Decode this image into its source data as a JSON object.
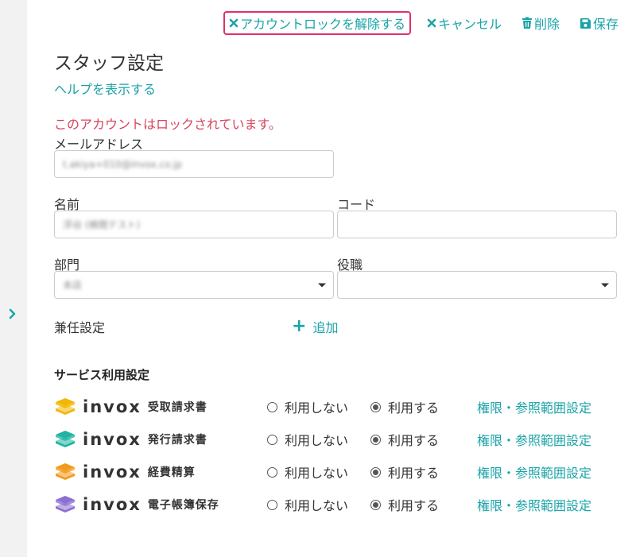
{
  "toolbar": {
    "unlock_label": "アカウントロックを解除する",
    "cancel_label": "キャンセル",
    "delete_label": "削除",
    "save_label": "保存"
  },
  "page": {
    "title": "スタッフ設定",
    "help_link": "ヘルプを表示する",
    "lock_message": "このアカウントはロックされています。"
  },
  "form": {
    "email_label": "メールアドレス",
    "email_value": "t.akiya+010@invox.co.jp",
    "name_label": "名前",
    "name_value": "浮谷 (検閲テスト)",
    "code_label": "コード",
    "code_value": "",
    "department_label": "部門",
    "department_value": "本店",
    "position_label": "役職",
    "position_value": "",
    "concurrent_label": "兼任設定",
    "add_label": "追加"
  },
  "services": {
    "section_title": "サービス利用設定",
    "brand": "invox",
    "not_use_label": "利用しない",
    "use_label": "利用する",
    "permission_link": "権限・参照範囲設定",
    "items": [
      {
        "name": "受取請求書",
        "color": "#f2b705",
        "selected": "use"
      },
      {
        "name": "発行請求書",
        "color": "#1fb5a2",
        "selected": "use"
      },
      {
        "name": "経費精算",
        "color": "#f39a1c",
        "selected": "use"
      },
      {
        "name": "電子帳簿保存",
        "color": "#8c6fd1",
        "selected": "use"
      }
    ]
  },
  "colors": {
    "accent": "#1aa3a8",
    "alert": "#d9435c",
    "highlight_border": "#e0306a"
  }
}
